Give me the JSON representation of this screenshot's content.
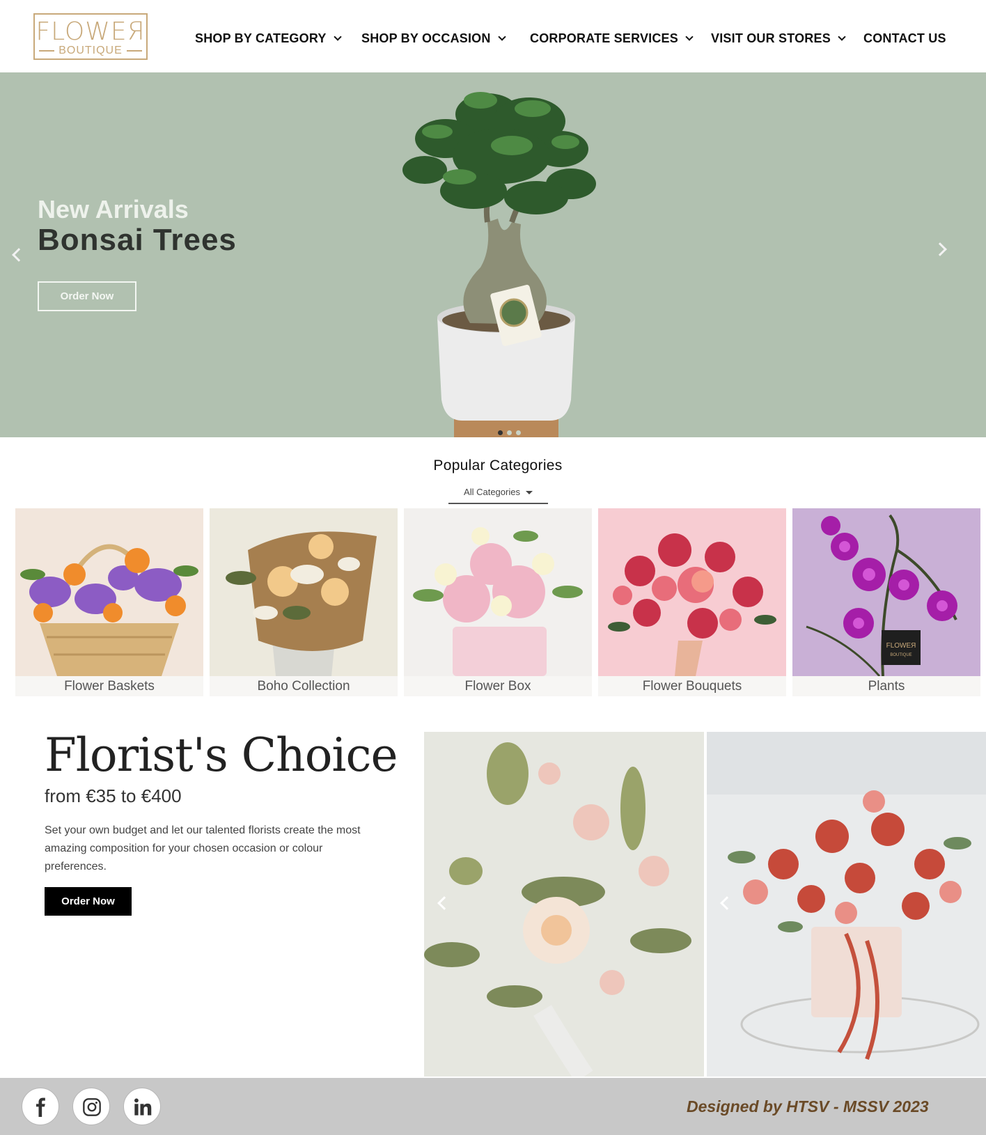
{
  "brand": {
    "logo_top": "FLOWEЯ",
    "logo_bottom": "BOUTIQUE",
    "color": "#c8a97a"
  },
  "nav": {
    "items": [
      {
        "label": "SHOP BY CATEGORY",
        "has_dropdown": true
      },
      {
        "label": "SHOP BY OCCASION",
        "has_dropdown": true
      },
      {
        "label": "CORPORATE SERVICES",
        "has_dropdown": true
      },
      {
        "label": "VISIT OUR STORES",
        "has_dropdown": true
      },
      {
        "label": "CONTACT US",
        "has_dropdown": false
      }
    ]
  },
  "hero": {
    "subtitle": "New Arrivals",
    "title": "Bonsai Trees",
    "button": "Order Now",
    "background": "#b1c1b0",
    "slide_count": 3,
    "active_slide": 1
  },
  "popular": {
    "title": "Popular Categories",
    "filter": "All Categories",
    "categories": [
      {
        "label": "Flower Baskets",
        "bg": "#f2e6dc"
      },
      {
        "label": "Boho Collection",
        "bg": "#ece9dd"
      },
      {
        "label": "Flower Box",
        "bg": "#f2f0ee"
      },
      {
        "label": "Flower Bouquets",
        "bg": "#f7ccd2"
      },
      {
        "label": "Plants",
        "bg": "#c9b0d6",
        "tag_top": "FLOWEЯ",
        "tag_bottom": "BOUTIQUE"
      }
    ]
  },
  "florist_choice": {
    "title": "Florist's Choice",
    "price": "from €35 to €400",
    "description": "Set your own budget and let our talented florists create the most amazing composition for your chosen occasion or colour preferences.",
    "button": "Order Now"
  },
  "footer": {
    "social": [
      "facebook-icon",
      "instagram-icon",
      "linkedin-icon"
    ],
    "credit": "Designed by HTSV - MSSV 2023",
    "credit_color": "#6a4a27"
  }
}
